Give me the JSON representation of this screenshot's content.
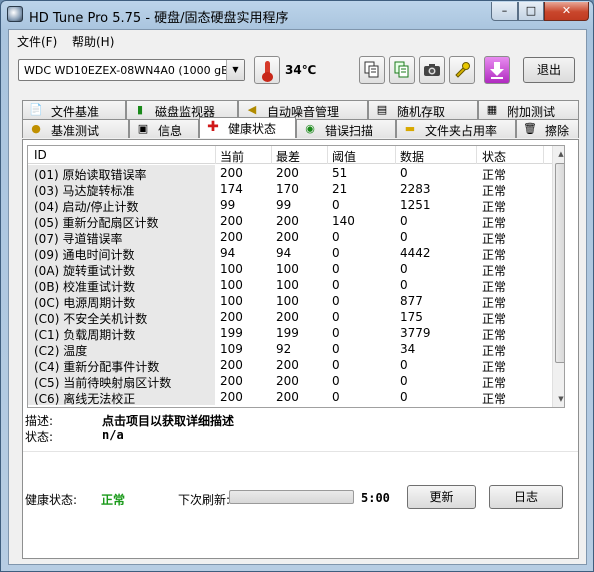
{
  "window": {
    "title": "HD Tune Pro 5.75 - 硬盘/固态硬盘实用程序",
    "minimize": "–",
    "maximize": "□",
    "close": "✕"
  },
  "menu": [
    {
      "label": "文件(F)"
    },
    {
      "label": "帮助(H)"
    }
  ],
  "toolbar": {
    "drive": "WDC WD10EZEX-08WN4A0 (1000 gB)",
    "temperature": "34℃",
    "exit_label": "退出",
    "icons": [
      "copy-icon",
      "copy-all-icon",
      "camera-icon",
      "options-icon",
      "download-icon"
    ]
  },
  "tabs": {
    "row1": [
      {
        "label": "文件基准",
        "icon": "file-benchmark-icon"
      },
      {
        "label": "磁盘监视器",
        "icon": "disk-monitor-icon"
      },
      {
        "label": "自动噪音管理",
        "icon": "speaker-icon"
      },
      {
        "label": "随机存取",
        "icon": "random-access-icon"
      },
      {
        "label": "附加测试",
        "icon": "extra-tests-icon"
      }
    ],
    "row2": [
      {
        "label": "基准测试",
        "icon": "benchmark-icon"
      },
      {
        "label": "信息",
        "icon": "info-icon"
      },
      {
        "label": "健康状态",
        "icon": "health-icon",
        "active": true
      },
      {
        "label": "错误扫描",
        "icon": "error-scan-icon"
      },
      {
        "label": "文件夹占用率",
        "icon": "folder-usage-icon"
      },
      {
        "label": "擦除",
        "icon": "erase-icon"
      }
    ]
  },
  "health": {
    "columns": [
      "ID",
      "当前",
      "最差",
      "阈值",
      "数据",
      "状态"
    ],
    "rows": [
      [
        "(01) 原始读取错误率",
        "200",
        "200",
        "51",
        "0",
        "正常"
      ],
      [
        "(03) 马达旋转标准",
        "174",
        "170",
        "21",
        "2283",
        "正常"
      ],
      [
        "(04) 启动/停止计数",
        "99",
        "99",
        "0",
        "1251",
        "正常"
      ],
      [
        "(05) 重新分配扇区计数",
        "200",
        "200",
        "140",
        "0",
        "正常"
      ],
      [
        "(07) 寻道错误率",
        "200",
        "200",
        "0",
        "0",
        "正常"
      ],
      [
        "(09) 通电时间计数",
        "94",
        "94",
        "0",
        "4442",
        "正常"
      ],
      [
        "(0A) 旋转重试计数",
        "100",
        "100",
        "0",
        "0",
        "正常"
      ],
      [
        "(0B) 校准重试计数",
        "100",
        "100",
        "0",
        "0",
        "正常"
      ],
      [
        "(0C) 电源周期计数",
        "100",
        "100",
        "0",
        "877",
        "正常"
      ],
      [
        "(C0) 不安全关机计数",
        "200",
        "200",
        "0",
        "175",
        "正常"
      ],
      [
        "(C1) 负载周期计数",
        "199",
        "199",
        "0",
        "3779",
        "正常"
      ],
      [
        "(C2) 温度",
        "109",
        "92",
        "0",
        "34",
        "正常"
      ],
      [
        "(C4) 重新分配事件计数",
        "200",
        "200",
        "0",
        "0",
        "正常"
      ],
      [
        "(C5) 当前待映射扇区计数",
        "200",
        "200",
        "0",
        "0",
        "正常"
      ],
      [
        "(C6) 离线无法校正",
        "200",
        "200",
        "0",
        "0",
        "正常"
      ]
    ],
    "description_label": "描述:",
    "description_value": "点击项目以获取详细描述",
    "state_label": "状态:",
    "state_value": "n/a",
    "health_label": "健康状态:",
    "health_value": "正常",
    "next_refresh_label": "下次刷新:",
    "next_refresh_time": "5:00",
    "refresh_progress": 0,
    "refresh_button": "更新",
    "log_button": "日志",
    "status_color": "#1a9a1a"
  }
}
